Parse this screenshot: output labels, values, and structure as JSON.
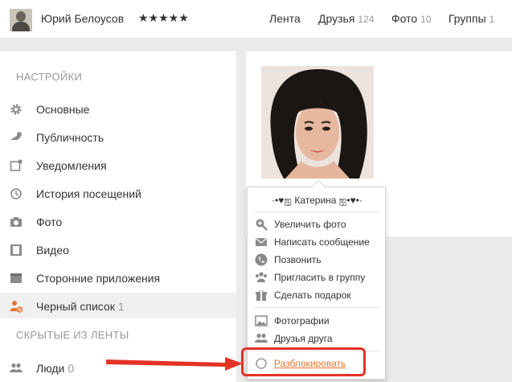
{
  "header": {
    "user_name": "Юрий Белоусов",
    "stars": "★★★★★",
    "nav": [
      {
        "label": "Лента",
        "count": ""
      },
      {
        "label": "Друзья",
        "count": "124"
      },
      {
        "label": "Фото",
        "count": "10"
      },
      {
        "label": "Группы",
        "count": "1"
      }
    ]
  },
  "sidebar": {
    "settings_title": "НАСТРОЙКИ",
    "items": [
      {
        "label": "Основные",
        "icon": "gear-icon"
      },
      {
        "label": "Публичность",
        "icon": "key-icon"
      },
      {
        "label": "Уведомления",
        "icon": "notification-icon"
      },
      {
        "label": "История посещений",
        "icon": "history-icon"
      },
      {
        "label": "Фото",
        "icon": "camera-icon"
      },
      {
        "label": "Видео",
        "icon": "film-icon"
      },
      {
        "label": "Сторонние приложения",
        "icon": "apps-icon"
      },
      {
        "label": "Черный список",
        "count": "1",
        "icon": "blocked-user-icon"
      }
    ],
    "hidden_title": "СКРЫТЫЕ ИЗ ЛЕНТЫ",
    "hidden_items": [
      {
        "label": "Люди",
        "count": "0",
        "icon": "people-icon"
      }
    ]
  },
  "menu": {
    "user_name": "·•♥ஐ Катерина ஐ•♥•·",
    "items": [
      {
        "label": "Увеличить фото",
        "icon": "zoom-in-icon"
      },
      {
        "label": "Написать сообщение",
        "icon": "envelope-icon"
      },
      {
        "label": "Позвонить",
        "icon": "phone-icon"
      },
      {
        "label": "Пригласить в группу",
        "icon": "group-icon"
      },
      {
        "label": "Сделать подарок",
        "icon": "gift-icon"
      }
    ],
    "items2": [
      {
        "label": "Фотографии",
        "icon": "photo-icon"
      },
      {
        "label": "Друзья друга",
        "icon": "friends-icon"
      }
    ],
    "unblock_label": "Разблокировать"
  },
  "colors": {
    "accent": "#eb722e",
    "highlight": "#e33224"
  }
}
